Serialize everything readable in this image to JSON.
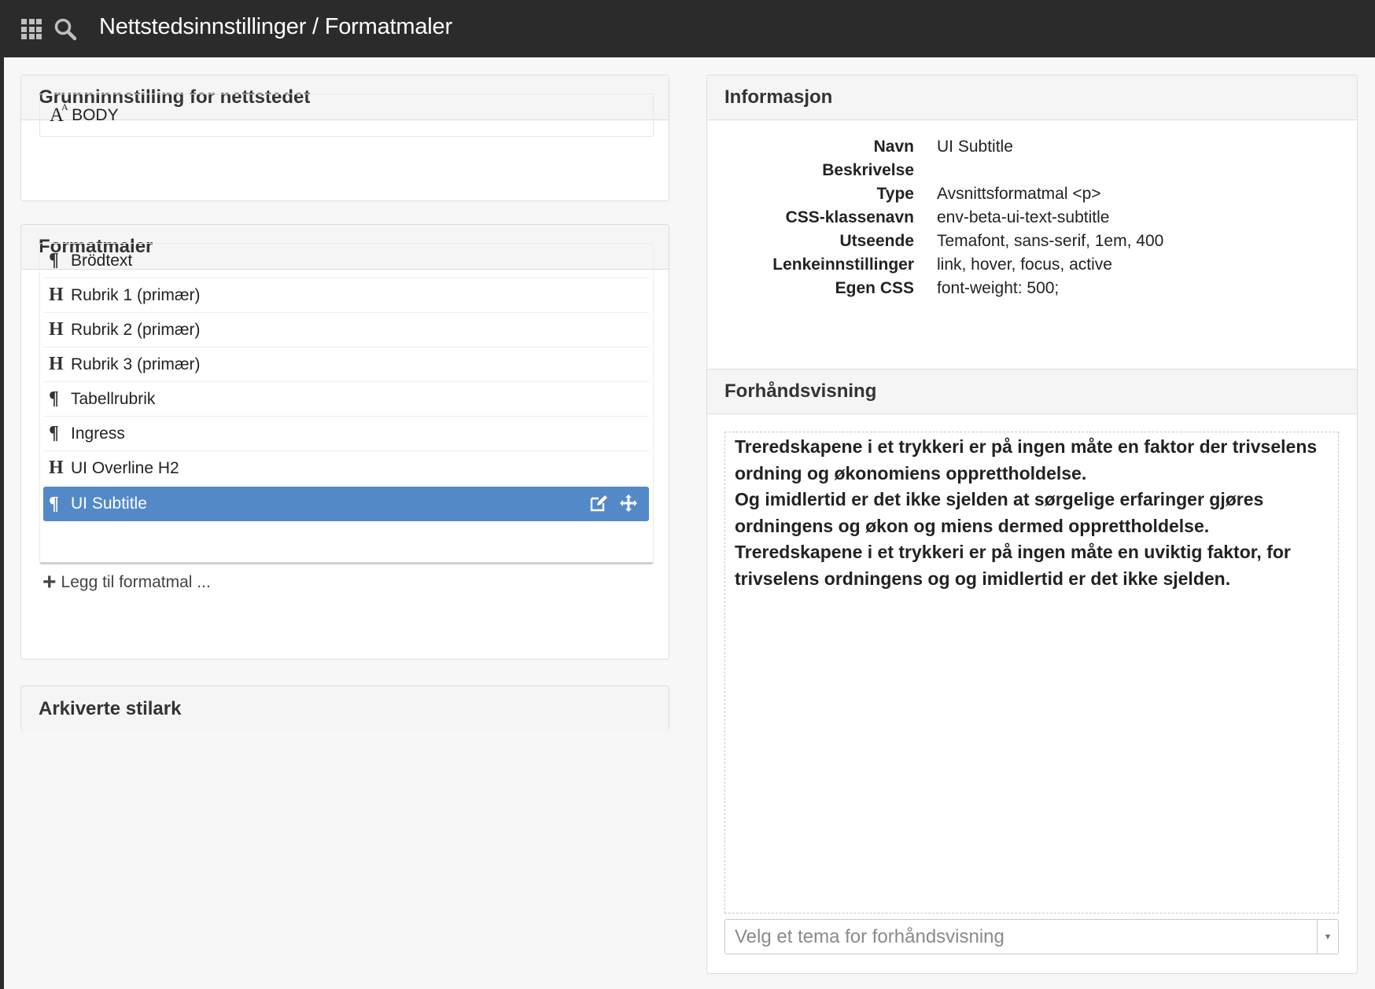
{
  "topbar": {
    "title": "Nettstedsinnstillinger / Formatmaler",
    "apps_icon": "grid-icon",
    "search_icon": "search-icon"
  },
  "base_panel": {
    "title": "Grunninnstilling for nettstedet",
    "item_label": "BODY",
    "item_icon": "font-size-icon"
  },
  "styles_panel": {
    "title": "Formatmaler",
    "items": [
      {
        "symbol": "¶",
        "label": "Brödtext",
        "icon": "paragraph-icon"
      },
      {
        "symbol": "H",
        "label": "Rubrik 1 (primær)",
        "icon": "heading-icon"
      },
      {
        "symbol": "H",
        "label": "Rubrik 2 (primær)",
        "icon": "heading-icon"
      },
      {
        "symbol": "H",
        "label": "Rubrik 3 (primær)",
        "icon": "heading-icon"
      },
      {
        "symbol": "¶",
        "label": "Tabellrubrik",
        "icon": "paragraph-icon"
      },
      {
        "symbol": "¶",
        "label": "Ingress",
        "icon": "paragraph-icon"
      },
      {
        "symbol": "H",
        "label": "UI Overline H2",
        "icon": "heading-icon"
      },
      {
        "symbol": "¶",
        "label": "UI Subtitle",
        "icon": "paragraph-icon",
        "selected": true
      }
    ],
    "add_label": "Legg til formatmal ..."
  },
  "archived_panel": {
    "title": "Arkiverte stilark"
  },
  "info_panel": {
    "title": "Informasjon",
    "rows": [
      {
        "label": "Navn",
        "value": "UI Subtitle"
      },
      {
        "label": "Beskrivelse",
        "value": ""
      },
      {
        "label": "Type",
        "value": "Avsnittsformatmal <p>"
      },
      {
        "label": "CSS-klassenavn",
        "value": "env-beta-ui-text-subtitle"
      },
      {
        "label": "Utseende",
        "value": "Temafont, sans-serif, 1em, 400"
      },
      {
        "label": "Lenkeinnstillinger",
        "value": "link, hover, focus, active"
      },
      {
        "label": "Egen CSS",
        "value": "font-weight: 500;"
      }
    ]
  },
  "preview_panel": {
    "title": "Forhåndsvisning",
    "paragraphs": [
      "Treredskapene i et trykkeri er på ingen måte en faktor der trivselens ordning og økonomiens opprettholdelse.",
      "Og imidlertid er det ikke sjelden at sørgelige erfaringer gjøres ordningens og økon og miens dermed opprettholdelse.",
      "Treredskapene i et trykkeri er på ingen måte en uviktig faktor, for trivselens ordningens og og imidlertid er det ikke sjelden."
    ],
    "theme_placeholder": "Velg et tema for forhåndsvisning"
  },
  "colors": {
    "topbar": "#2b2b2b",
    "selected": "#5489c8",
    "background": "#f7f7f7"
  }
}
